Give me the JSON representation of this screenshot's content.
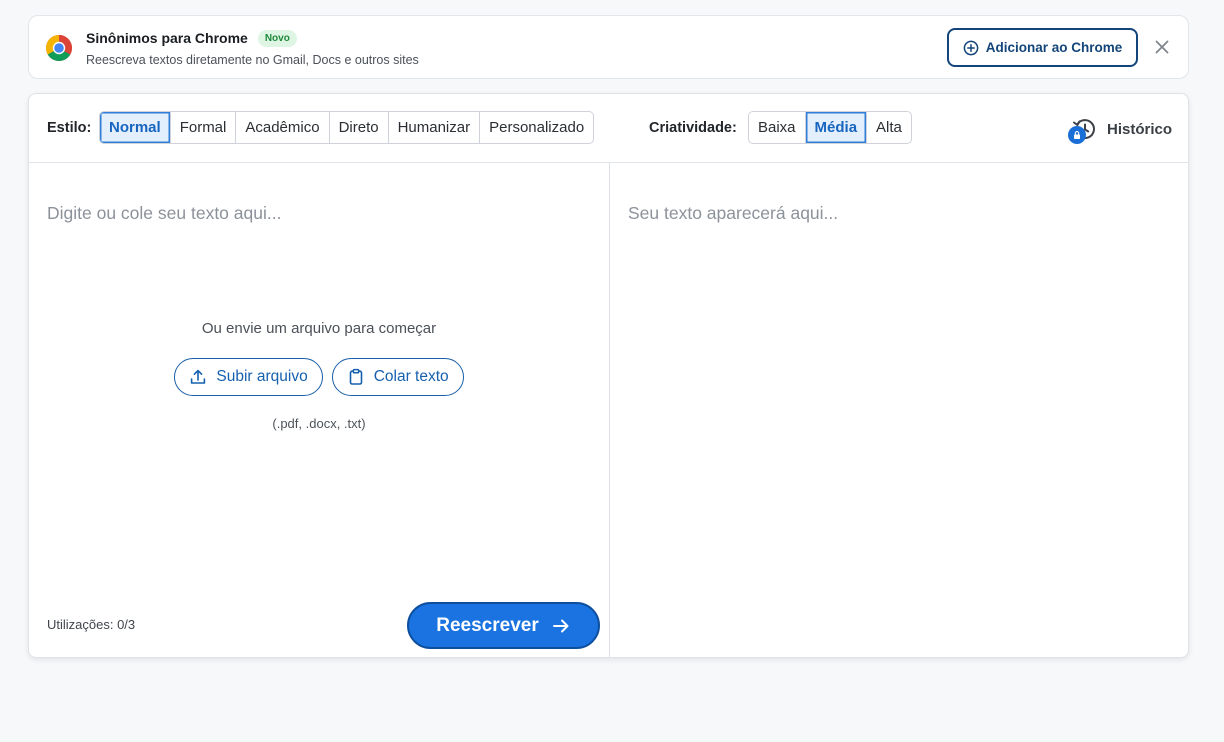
{
  "banner": {
    "title": "Sinônimos para Chrome",
    "badge": "Novo",
    "subtitle": "Reescreva textos diretamente no Gmail, Docs e outros sites",
    "add_button_label": "Adicionar ao Chrome",
    "icons": {
      "logo": "chrome-logo-icon",
      "add": "plus-circle-icon",
      "close": "close-icon"
    }
  },
  "toolbar": {
    "style_label": "Estilo:",
    "styles": [
      "Normal",
      "Formal",
      "Acadêmico",
      "Direto",
      "Humanizar",
      "Personalizado"
    ],
    "style_selected": "Normal",
    "creativity_label": "Criatividade:",
    "creativity": [
      "Baixa",
      "Média",
      "Alta"
    ],
    "creativity_selected": "Média",
    "history_label": "Histórico",
    "history_icon": "history-icon",
    "lock_icon": "lock-icon"
  },
  "editor": {
    "input_placeholder": "Digite ou cole seu texto aqui...",
    "output_placeholder": "Seu texto aparecerá aqui...",
    "upload_hint": "Ou envie um arquivo para começar",
    "upload_button_label": "Subir arquivo",
    "paste_button_label": "Colar texto",
    "formats": "(.pdf, .docx, .txt)",
    "usage": "Utilizações: 0/3",
    "rewrite_button_label": "Reescrever",
    "icons": {
      "upload": "upload-icon",
      "paste": "clipboard-icon",
      "rewrite": "arrow-right-icon"
    }
  },
  "colors": {
    "accent": "#1a73e0",
    "accent_dark": "#13457a",
    "selected_bg": "#e3effc",
    "badge_green": "#1e8a3c",
    "page_bg": "#f7f8fa"
  }
}
